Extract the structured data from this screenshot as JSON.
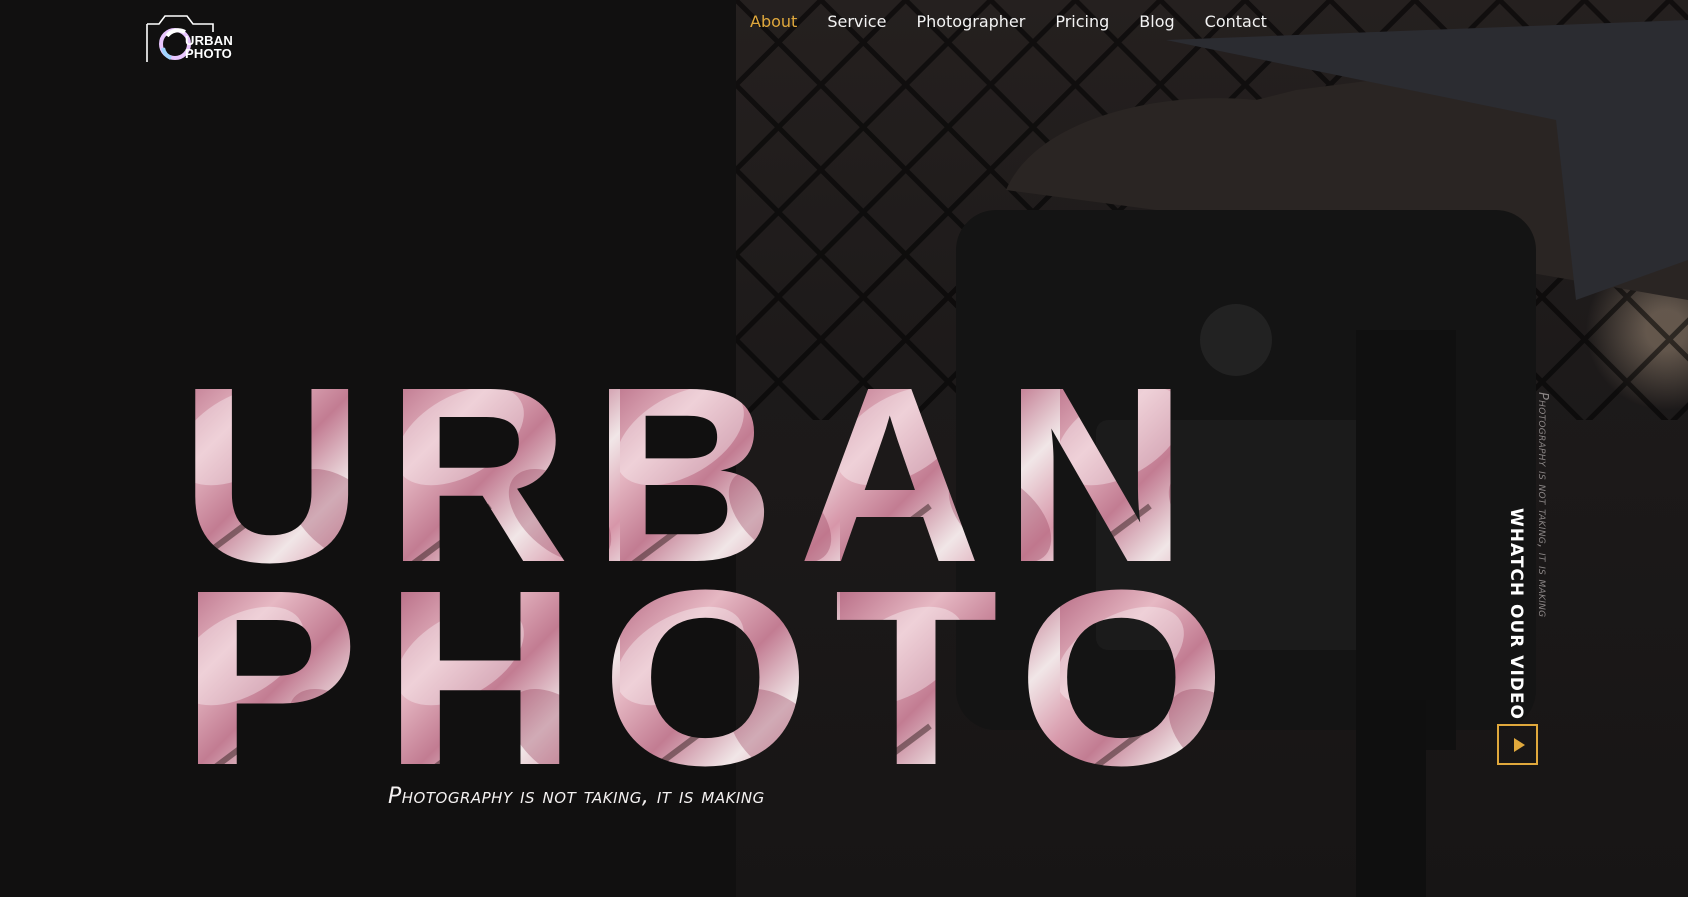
{
  "logo": {
    "line1": "URBAN",
    "line2": "PHOTO"
  },
  "nav": {
    "items": [
      {
        "label": "About",
        "active": true
      },
      {
        "label": "Service",
        "active": false
      },
      {
        "label": "Photographer",
        "active": false
      },
      {
        "label": "Pricing",
        "active": false
      },
      {
        "label": "Blog",
        "active": false
      },
      {
        "label": "Contact",
        "active": false
      }
    ]
  },
  "hero": {
    "line1": "URBAN",
    "line2": "PHOTO",
    "tagline": "Photography is not taking, it is making"
  },
  "video": {
    "side_text": "Photography is not taking, it is making",
    "label": "WHATCH OUR VIDEO",
    "play_icon": "play-icon"
  },
  "colors": {
    "accent": "#e0a83c",
    "background": "#111010",
    "petal_pink": "#c98ea0",
    "petal_light": "#efe3e4"
  }
}
